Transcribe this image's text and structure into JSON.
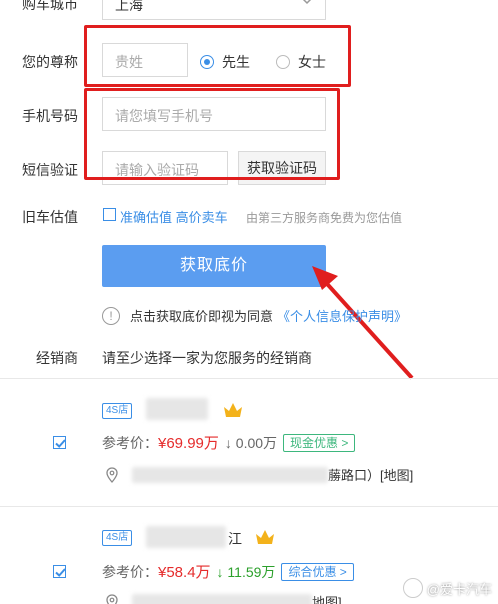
{
  "form": {
    "city_label": "购车城市",
    "city_value": "上海",
    "title_label": "您的尊称",
    "surname_placeholder": "贵姓",
    "gender_options": [
      "先生",
      "女士"
    ],
    "gender_selected": "先生",
    "phone_label": "手机号码",
    "phone_placeholder": "请您填写手机号",
    "sms_label": "短信验证",
    "sms_placeholder": "请输入验证码",
    "sms_button": "获取验证码",
    "oldcar_label": "旧车估值",
    "oldcar_link": "准确估值 高价卖车",
    "oldcar_note": "由第三方服务商免费为您估值",
    "submit": "获取底价",
    "privacy_prefix": "点击获取底价即视为同意",
    "privacy_link": "《个人信息保护声明》",
    "dealer_label": "经销商",
    "dealer_hint": "请至少选择一家为您服务的经销商"
  },
  "dealers": [
    {
      "tag": "4S店",
      "name_suffix": "",
      "checked": true,
      "price_label": "参考价：",
      "price": "¥69.99万",
      "drop": "↓ 0.00万",
      "promo": "现金优惠 >",
      "address_visible": "蕂路口）[地图]"
    },
    {
      "tag": "4S店",
      "name_suffix": "江",
      "checked": true,
      "price_label": "参考价：",
      "price": "¥58.4万",
      "drop": "↓ 11.59万",
      "promo": "综合优惠 >",
      "address_visible": "地图]"
    }
  ],
  "watermark": "@爱卡汽车",
  "colors": {
    "accent": "#3a8ee6",
    "submit_bg": "#5b9df0",
    "price_red": "#e52b2b",
    "annotation_red": "#e01e1e"
  }
}
